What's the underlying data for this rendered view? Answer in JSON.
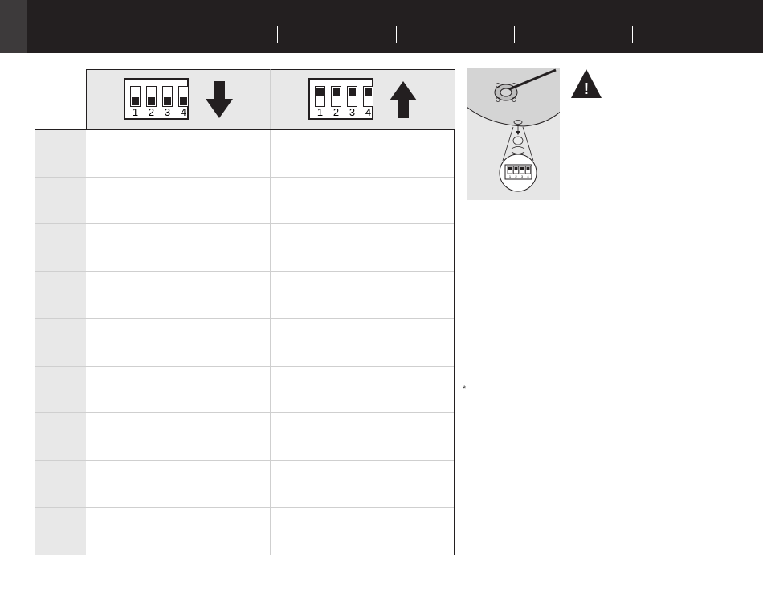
{
  "header": {
    "tabs": [
      "",
      "",
      "",
      "",
      ""
    ]
  },
  "table": {
    "columns": [
      {
        "switch_state": "down",
        "switch_numbers": [
          "1",
          "2",
          "3",
          "4"
        ],
        "arrow": "down-arrow-icon"
      },
      {
        "switch_state": "up",
        "switch_numbers": [
          "1",
          "2",
          "3",
          "4"
        ],
        "arrow": "up-arrow-icon"
      }
    ],
    "row_count": 9
  },
  "illustration": {
    "icon": "dip-switch-location-icon",
    "mini_switch_numbers": [
      "1",
      "2",
      "3",
      "4"
    ]
  },
  "warning": {
    "icon": "warning-triangle-icon",
    "symbol": "!"
  },
  "footnote": {
    "marker": "*"
  },
  "colors": {
    "dark": "#231f20",
    "light_gray": "#e8e8e8",
    "grid": "#cfcfcf"
  }
}
